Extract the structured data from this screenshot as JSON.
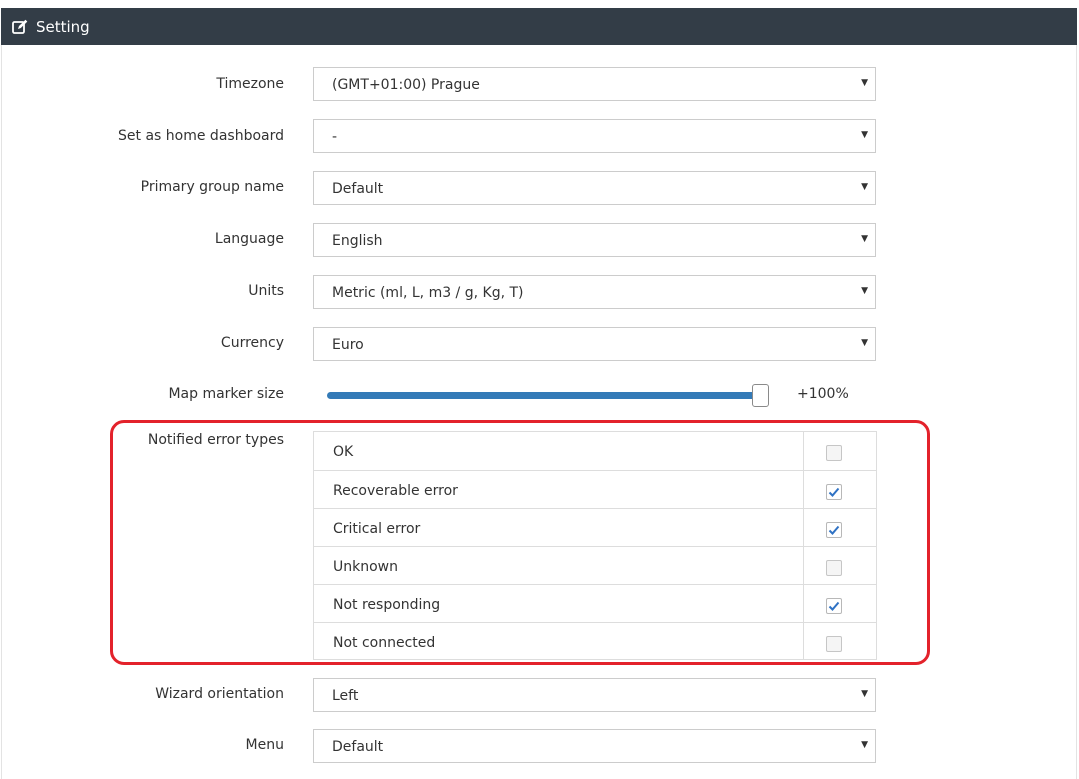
{
  "header": {
    "title": "Setting",
    "icon": "edit-icon"
  },
  "fields": {
    "timezone": {
      "label": "Timezone",
      "value": "(GMT+01:00) Prague"
    },
    "home_dashboard": {
      "label": "Set as home dashboard",
      "value": "-"
    },
    "primary_group": {
      "label": "Primary group name",
      "value": "Default"
    },
    "language": {
      "label": "Language",
      "value": "English"
    },
    "units": {
      "label": "Units",
      "value": "Metric (ml, L, m3 / g, Kg, T)"
    },
    "currency": {
      "label": "Currency",
      "value": "Euro"
    },
    "wizard_orientation": {
      "label": "Wizard orientation",
      "value": "Left"
    },
    "menu": {
      "label": "Menu",
      "value": "Default"
    }
  },
  "map_marker": {
    "label": "Map marker size",
    "value_text": "+100%",
    "level": 1.0
  },
  "notified_errors": {
    "label": "Notified error types",
    "items": [
      {
        "label": "OK",
        "checked": false
      },
      {
        "label": "Recoverable error",
        "checked": true
      },
      {
        "label": "Critical error",
        "checked": true
      },
      {
        "label": "Unknown",
        "checked": false
      },
      {
        "label": "Not responding",
        "checked": true
      },
      {
        "label": "Not connected",
        "checked": false
      }
    ]
  },
  "colors": {
    "header_bg": "#333d47",
    "slider_fill": "#337ab7",
    "highlight": "#e3222b",
    "check": "#2f72c4"
  }
}
